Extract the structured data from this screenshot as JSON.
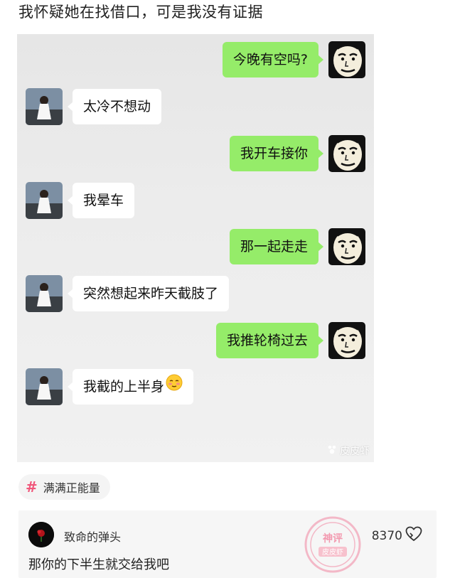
{
  "post": {
    "title": "我怀疑她在找借口，可是我没有证据"
  },
  "chat": {
    "messages": [
      {
        "side": "right",
        "text": "今晚有空吗?"
      },
      {
        "side": "left",
        "text": "太冷不想动"
      },
      {
        "side": "right",
        "text": "我开车接你"
      },
      {
        "side": "left",
        "text": "我晕车"
      },
      {
        "side": "right",
        "text": "那一起走走"
      },
      {
        "side": "left",
        "text": "突然想起来昨天截肢了"
      },
      {
        "side": "right",
        "text": "我推轮椅过去"
      },
      {
        "side": "left",
        "text": "我截的上半身",
        "emoji": "blush-emoji"
      }
    ],
    "watermark": "皮皮虾",
    "colors": {
      "green_bubble": "#95ec69",
      "white_bubble": "#ffffff",
      "background": "#ebebeb"
    }
  },
  "tag": {
    "icon": "hash-icon",
    "label": "满满正能量"
  },
  "comment": {
    "username": "致命的弹头",
    "text": "那你的下半生就交给我吧",
    "likes": "8370",
    "like_icon": "heart-icon",
    "stamp": {
      "top": "神评",
      "bottom": "皮皮虾",
      "color": "#f0567a"
    }
  }
}
